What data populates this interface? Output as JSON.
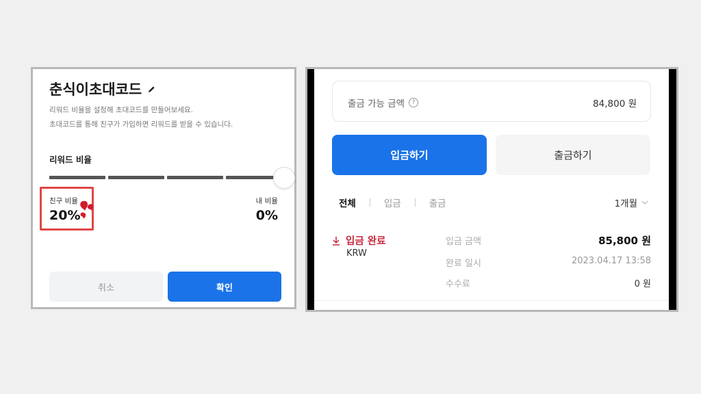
{
  "left": {
    "title": "춘식이초대코드",
    "description_line1": "리워드 비율을 설정해 초대코드를 만들어보세요.",
    "description_line2": "초대코드를 통해 친구가 가입하면 리워드를 받을 수 있습니다.",
    "reward_ratio_label": "리워드 비율",
    "friend_ratio_label": "친구 비율",
    "friend_ratio_value": "20%",
    "my_ratio_label": "내 비율",
    "my_ratio_value": "0%",
    "cancel_label": "취소",
    "confirm_label": "확인",
    "accent_color": "#1a73e8",
    "highlight_color": "#e04646"
  },
  "right": {
    "withdrawable_label": "출금 가능 금액",
    "withdrawable_value": "84,800 원",
    "deposit_button": "입금하기",
    "withdraw_button": "출금하기",
    "tabs": [
      "전체",
      "입금",
      "출금"
    ],
    "active_tab": "전체",
    "period": "1개월",
    "transaction": {
      "status": "입금 완료",
      "currency": "KRW",
      "rows": [
        {
          "label": "입금 금액",
          "value": "85,800 원"
        },
        {
          "label": "완료 일시",
          "value": "2023.04.17 13:58"
        },
        {
          "label": "수수료",
          "value": "0 원"
        }
      ]
    },
    "status_color": "#c8283c"
  }
}
